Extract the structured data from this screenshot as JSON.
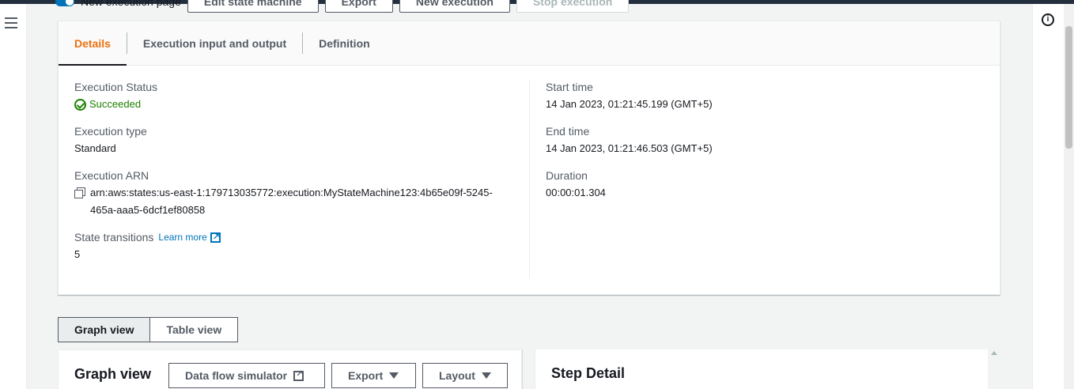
{
  "top_actions": {
    "toggle_label": "New execution page",
    "buttons": [
      "Edit state machine",
      "Export",
      "New execution",
      "Stop execution"
    ]
  },
  "tabs": [
    {
      "label": "Details",
      "active": true
    },
    {
      "label": "Execution input and output",
      "active": false
    },
    {
      "label": "Definition",
      "active": false
    }
  ],
  "details": {
    "status_label": "Execution Status",
    "status_value": "Succeeded",
    "type_label": "Execution type",
    "type_value": "Standard",
    "arn_label": "Execution ARN",
    "arn_value": "arn:aws:states:us-east-1:179713035772:execution:MyStateMachine123:4b65e09f-5245-465a-aaa5-6dcf1ef80858",
    "transitions_label": "State transitions",
    "learn_more": "Learn more",
    "transitions_value": "5",
    "start_label": "Start time",
    "start_value": "14 Jan 2023, 01:21:45.199 (GMT+5)",
    "end_label": "End time",
    "end_value": "14 Jan 2023, 01:21:46.503 (GMT+5)",
    "duration_label": "Duration",
    "duration_value": "00:00:01.304"
  },
  "views": {
    "graph": "Graph view",
    "table": "Table view",
    "active": "graph"
  },
  "graph_panel": {
    "title": "Graph view",
    "simulator": "Data flow simulator",
    "export": "Export",
    "layout": "Layout"
  },
  "step_panel": {
    "title": "Step Detail"
  },
  "colors": {
    "accent_tab": "#ec7211",
    "success": "#1d8102",
    "link": "#0073bb"
  }
}
